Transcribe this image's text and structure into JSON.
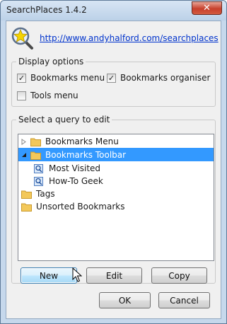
{
  "window": {
    "title": "SearchPlaces 1.4.2",
    "close_label": "✕"
  },
  "header": {
    "link": "http://www.andyhalford.com/searchplaces"
  },
  "display_options": {
    "label": "Display options",
    "bookmarks_menu": {
      "label": "Bookmarks menu",
      "checked": true
    },
    "bookmarks_organiser": {
      "label": "Bookmarks organiser",
      "checked": true
    },
    "tools_menu": {
      "label": "Tools menu",
      "checked": false
    }
  },
  "query_group": {
    "label": "Select a query to edit",
    "tree": [
      {
        "label": "Bookmarks Menu",
        "type": "folder",
        "level": 0,
        "expander": "collapsed"
      },
      {
        "label": "Bookmarks Toolbar",
        "type": "folder",
        "level": 0,
        "expander": "expanded",
        "selected": true
      },
      {
        "label": "Most Visited",
        "type": "query",
        "level": 1
      },
      {
        "label": "How-To Geek",
        "type": "query",
        "level": 1
      },
      {
        "label": "Tags",
        "type": "folder",
        "level": 0
      },
      {
        "label": "Unsorted Bookmarks",
        "type": "folder",
        "level": 0
      }
    ],
    "buttons": {
      "new": "New",
      "edit": "Edit",
      "copy": "Copy"
    }
  },
  "footer": {
    "ok": "OK",
    "cancel": "Cancel"
  },
  "colors": {
    "selection": "#3399ff",
    "link": "#0033cc",
    "folder": "#f3c85a",
    "close": "#c7402c"
  }
}
